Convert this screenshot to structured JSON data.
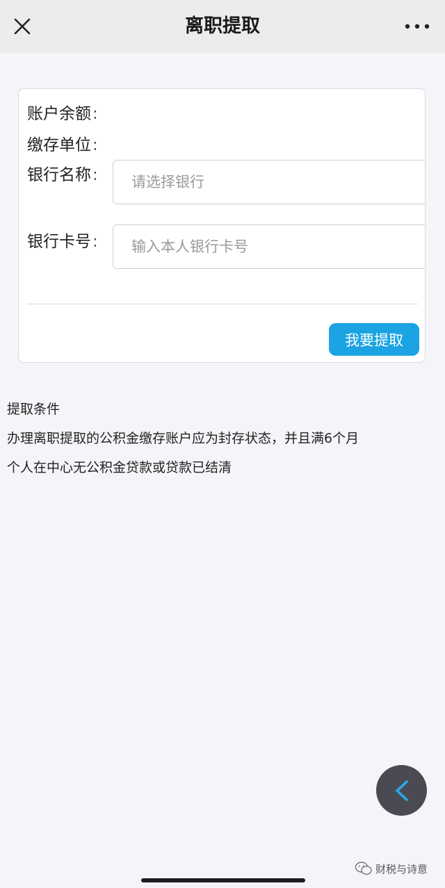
{
  "header": {
    "title": "离职提取",
    "close_icon": "close-icon",
    "more_icon": "more-dots-icon"
  },
  "form": {
    "balance_label": "账户余额",
    "employer_label": "缴存单位",
    "bank_label": "银行名称",
    "bank_placeholder": "请选择银行",
    "card_label": "银行卡号",
    "card_placeholder": "输入本人银行卡号",
    "colon": ":",
    "submit_label": "我要提取"
  },
  "conditions": {
    "title": "提取条件",
    "line1": "办理离职提取的公积金缴存账户应为封存状态，并且满6个月",
    "line2": "个人在中心无公积金贷款或贷款已结清"
  },
  "fab": {
    "icon": "chevron-left-icon"
  },
  "watermark": {
    "text": "财税与诗意",
    "icon": "wechat-icon"
  },
  "colors": {
    "accent": "#1ba3e3",
    "header_bg": "#ececec",
    "page_bg": "#f5f4f8",
    "fab_bg": "#4a4a52"
  }
}
